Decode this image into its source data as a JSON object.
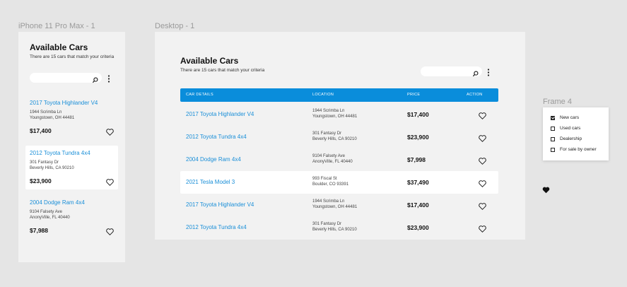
{
  "frames": {
    "mobile_label": "iPhone 11 Pro Max - 1",
    "desktop_label": "Desktop - 1",
    "filter_label": "Frame 4"
  },
  "mobile": {
    "title": "Available Cars",
    "subtitle": "There are 15 cars that match your criteria",
    "search_placeholder": "",
    "cards": [
      {
        "name": "2017 Toyota Highlander V4",
        "addr1": "1944 Scrimba Ln",
        "addr2": "Youngstown, OH 44481",
        "price": "$17,400",
        "highlighted": false
      },
      {
        "name": "2012 Toyota Tundra 4x4",
        "addr1": "301 Fantasy Dr",
        "addr2": "Beverly Hills, CA 90210",
        "price": "$23,900",
        "highlighted": true
      },
      {
        "name": "2004 Dodge Ram 4x4",
        "addr1": "9104 Falsety Ave",
        "addr2": "AnonyVille, FL 40440",
        "price": "$7,988",
        "highlighted": false
      }
    ]
  },
  "desktop": {
    "title": "Available Cars",
    "subtitle": "There are 15 cars that match your criteria",
    "search_placeholder": "",
    "columns": [
      "CAR DETAILS",
      "LOCATION",
      "PRICE",
      "ACTION"
    ],
    "rows": [
      {
        "name": "2017 Toyota Highlander V4",
        "addr1": "1944 Scrimba Ln",
        "addr2": "Youngstown, OH 44481",
        "price": "$17,400",
        "highlighted": false
      },
      {
        "name": "2012 Toyota Tundra 4x4",
        "addr1": "301 Fantasy Dr",
        "addr2": "Beverly Hills, CA 90210",
        "price": "$23,900",
        "highlighted": false
      },
      {
        "name": "2004 Dodge Ram 4x4",
        "addr1": "9104 Falsety Ave",
        "addr2": "AnonyVille, FL 40440",
        "price": "$7,998",
        "highlighted": false
      },
      {
        "name": "2021 Tesla Model 3",
        "addr1": "993 Fiscal St",
        "addr2": "Boulder, CO 93391",
        "price": "$37,490",
        "highlighted": true
      },
      {
        "name": "2017 Toyota Highlander V4",
        "addr1": "1944 Scrimba Ln",
        "addr2": "Youngstown, OH 44481",
        "price": "$17,400",
        "highlighted": false
      },
      {
        "name": "2012 Toyota Tundra 4x4",
        "addr1": "301 Fantasy Dr",
        "addr2": "Beverly Hills, CA 90210",
        "price": "$23,900",
        "highlighted": false
      }
    ]
  },
  "filters": [
    {
      "label": "New cars",
      "checked": true
    },
    {
      "label": "Used cars",
      "checked": false
    },
    {
      "label": "Dealership",
      "checked": false
    },
    {
      "label": "For sale by owner",
      "checked": false
    }
  ],
  "colors": {
    "accent": "#0a8ddb",
    "link": "#1a8fd8",
    "canvas": "#e5e5e5",
    "frame": "#f2f2f2"
  },
  "icons": {
    "search": "search-icon",
    "more": "kebab-menu-icon",
    "favorite": "heart-icon",
    "favorite_filled": "heart-filled-icon"
  }
}
